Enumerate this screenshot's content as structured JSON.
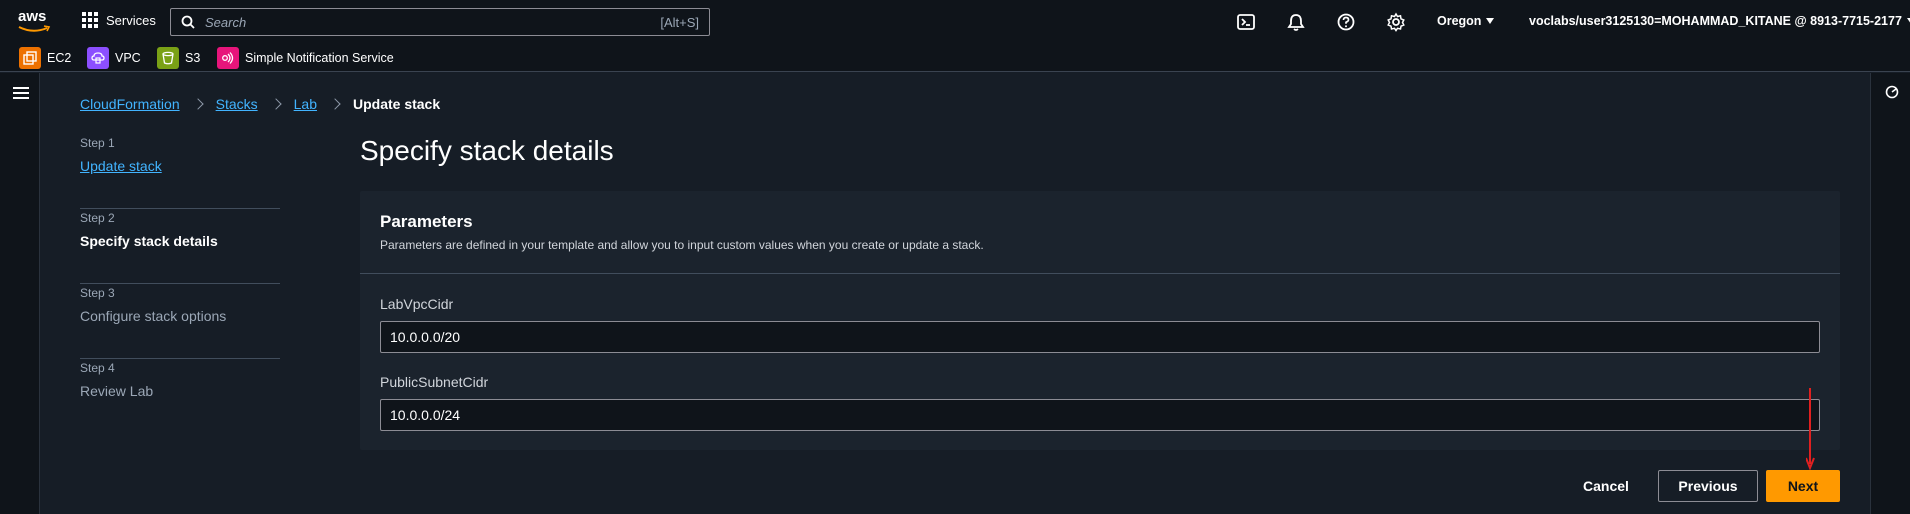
{
  "topbar": {
    "logo_text": "aws",
    "services_label": "Services",
    "search_placeholder": "Search",
    "search_shortcut": "[Alt+S]",
    "icons": [
      "cloudshell-icon",
      "notifications-icon",
      "help-icon",
      "settings-icon"
    ],
    "region": "Oregon",
    "account": "voclabs/user3125130=MOHAMMAD_KITANE @ 8913-7715-2177"
  },
  "favorites": [
    {
      "label": "EC2",
      "icon": "ec2-icon",
      "color": "#ed7100"
    },
    {
      "label": "VPC",
      "icon": "vpc-icon",
      "color": "#8c4fff"
    },
    {
      "label": "S3",
      "icon": "s3-icon",
      "color": "#7aa116"
    },
    {
      "label": "Simple Notification Service",
      "icon": "sns-icon",
      "color": "#e7157b"
    }
  ],
  "breadcrumb": {
    "items": [
      "CloudFormation",
      "Stacks",
      "Lab"
    ],
    "current": "Update stack"
  },
  "steps": [
    {
      "num": "Step 1",
      "label": "Update stack",
      "state": "link"
    },
    {
      "num": "Step 2",
      "label": "Specify stack details",
      "state": "active"
    },
    {
      "num": "Step 3",
      "label": "Configure stack options",
      "state": "inactive"
    },
    {
      "num": "Step 4",
      "label": "Review Lab",
      "state": "inactive"
    }
  ],
  "main": {
    "title": "Specify stack details",
    "panel_title": "Parameters",
    "panel_desc": "Parameters are defined in your template and allow you to input custom values when you create or update a stack.",
    "params": [
      {
        "label": "LabVpcCidr",
        "value": "10.0.0.0/20"
      },
      {
        "label": "PublicSubnetCidr",
        "value": "10.0.0.0/24"
      }
    ]
  },
  "actions": {
    "cancel": "Cancel",
    "previous": "Previous",
    "next": "Next"
  },
  "colors": {
    "accent": "#ff9900",
    "link": "#42b4ff",
    "annotation": "#e02020"
  }
}
